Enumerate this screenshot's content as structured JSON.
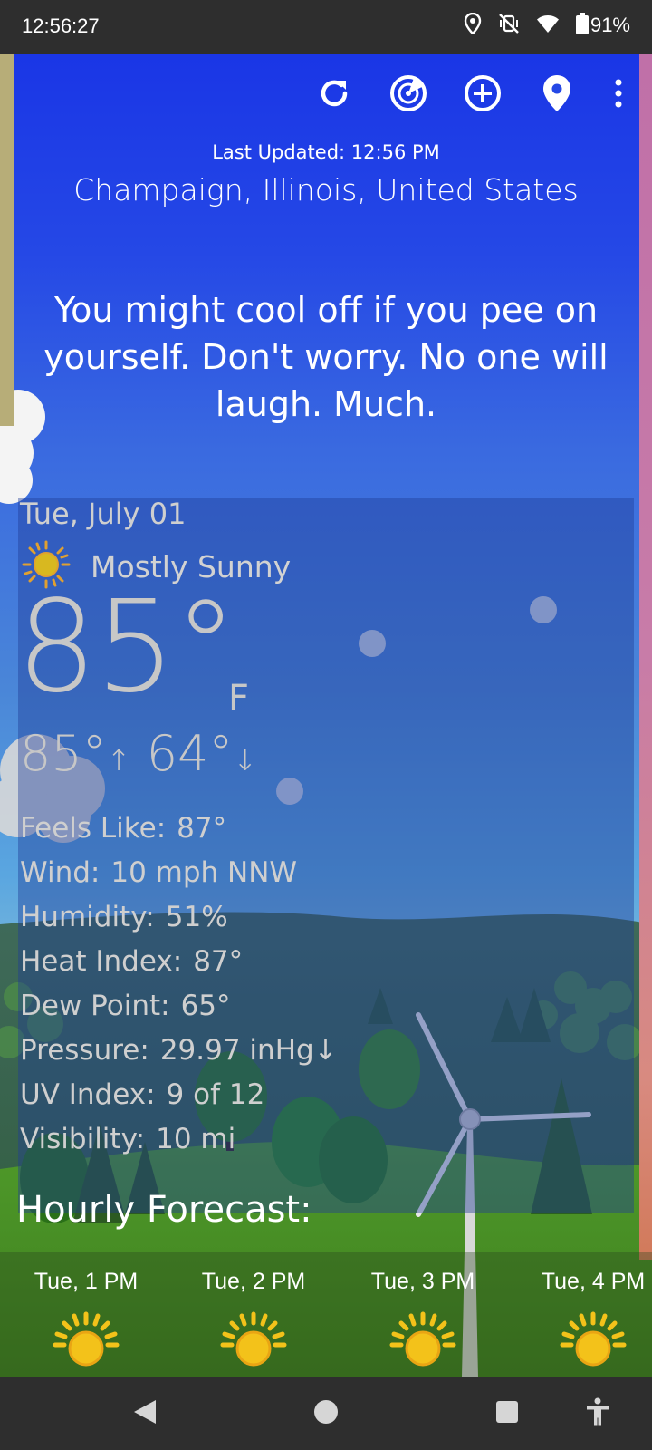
{
  "status_bar": {
    "time": "12:56:27",
    "battery": "91%",
    "icons": [
      "location-icon",
      "vibrate-off-icon",
      "wifi-icon",
      "battery-icon"
    ]
  },
  "toolbar": {
    "icons": [
      "refresh-icon",
      "radar-icon",
      "add-location-icon",
      "location-pin-icon",
      "more-icon"
    ]
  },
  "header": {
    "last_updated": "Last Updated: 12:56 PM",
    "location": "Champaign, Illinois, United States"
  },
  "quip": "You might cool off if you pee on yourself. Don't worry. No one will laugh. Much.",
  "current": {
    "date": "Tue, July 01",
    "condition": "Mostly Sunny",
    "condition_icon": "sun-icon",
    "temperature": "85°",
    "unit": "F",
    "high": "85°",
    "low": "64°",
    "details": [
      {
        "label": "Feels Like:",
        "value": "87°"
      },
      {
        "label": "Wind:",
        "value": "10 mph NNW"
      },
      {
        "label": "Humidity:",
        "value": "51%"
      },
      {
        "label": "Heat Index:",
        "value": "87°"
      },
      {
        "label": "Dew Point:",
        "value": "65°"
      },
      {
        "label": "Pressure:",
        "value": "29.97 inHg↓"
      },
      {
        "label": "UV Index:",
        "value": "9 of 12"
      },
      {
        "label": "Visibility:",
        "value": "10 mi"
      }
    ]
  },
  "hourly": {
    "title": "Hourly Forecast:",
    "items": [
      {
        "time": "Tue, 1 PM",
        "icon": "sun-icon"
      },
      {
        "time": "Tue, 2 PM",
        "icon": "sun-icon"
      },
      {
        "time": "Tue, 3 PM",
        "icon": "sun-icon"
      },
      {
        "time": "Tue, 4 PM",
        "icon": "sun-icon"
      }
    ]
  },
  "nav": {
    "icons": [
      "back-icon",
      "home-icon",
      "recents-icon",
      "accessibility-icon"
    ]
  },
  "colors": {
    "sky_top": "#1a36e6",
    "sun": "#f3c21a",
    "status_bg": "#2e2e2e"
  }
}
